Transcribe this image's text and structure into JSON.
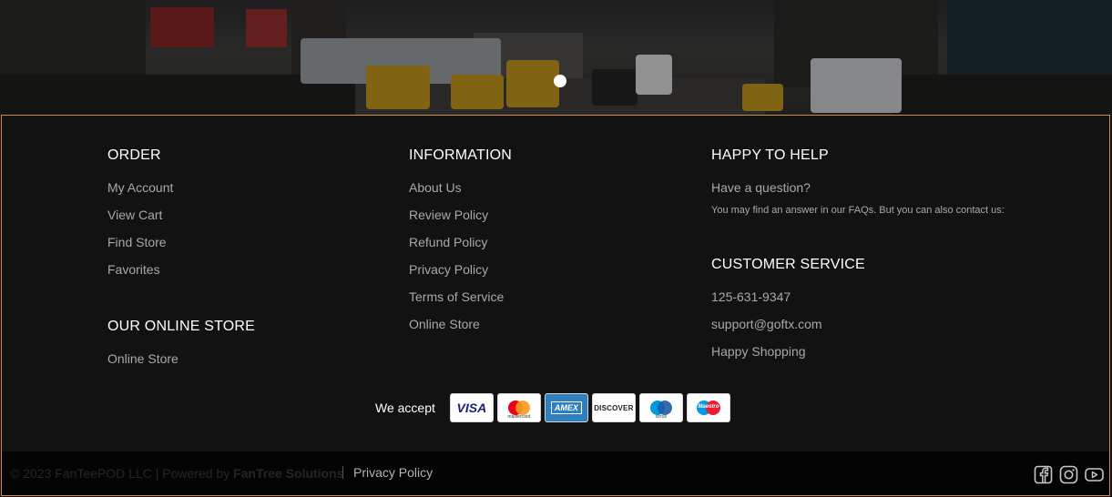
{
  "footer": {
    "order": {
      "heading": "ORDER",
      "links": [
        "My Account",
        "View Cart",
        "Find Store",
        "Favorites"
      ]
    },
    "online_store": {
      "heading": "OUR ONLINE STORE",
      "links": [
        "Online Store"
      ]
    },
    "information": {
      "heading": "INFORMATION",
      "links": [
        "About Us",
        "Review Policy",
        "Refund Policy",
        "Privacy Policy",
        "Terms of Service",
        "Online Store"
      ]
    },
    "help": {
      "heading": "HAPPY TO HELP",
      "question": "Have a question?",
      "note": "You may find an answer in our FAQs. But you can also contact us:"
    },
    "customer_service": {
      "heading": "CUSTOMER SERVICE",
      "phone": "125-631-9347",
      "email": "support@goftx.com",
      "tagline": "Happy Shopping"
    },
    "payments": {
      "label": "We accept",
      "cards": [
        "VISA",
        "mastercard",
        "AMEX",
        "DISCOVER",
        "cirrus",
        "Maestro"
      ]
    },
    "bottom": {
      "copyright_prefix": "© 2023 FanTeePOD LLC | Powered by ",
      "powered_by": "FanTree Solutions",
      "privacy": "Privacy Policy",
      "social": [
        "facebook-icon",
        "instagram-icon",
        "youtube-icon"
      ]
    }
  },
  "colors": {
    "background": "#121212",
    "border": "#d18a48",
    "heading": "#ffffff",
    "link": "#a9a9a9"
  }
}
